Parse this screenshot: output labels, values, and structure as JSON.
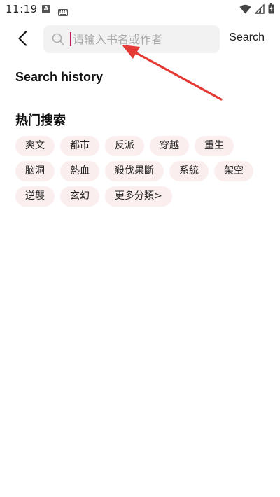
{
  "status_bar": {
    "time": "11:19",
    "notification_letter": "A"
  },
  "header": {
    "search_placeholder": "请输入书名或作者",
    "search_button_label": "Search"
  },
  "sections": {
    "history_title": "Search history",
    "hot_title": "热门搜索"
  },
  "hot_tags": [
    [
      "爽文",
      "都市",
      "反派",
      "穿越",
      "重生"
    ],
    [
      "脑洞",
      "熱血",
      "殺伐果斷",
      "系統",
      "架空"
    ],
    [
      "逆襲",
      "玄幻",
      "更多分類>"
    ]
  ],
  "colors": {
    "tag_background": "#fbeeee",
    "caret": "#c2185b",
    "annotation_arrow": "#e53935"
  }
}
